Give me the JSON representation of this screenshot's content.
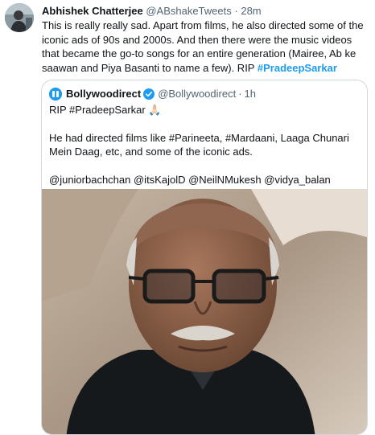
{
  "tweet": {
    "author_name": "Abhishek Chatterjee",
    "author_handle": "@ABshakeTweets",
    "separator": "·",
    "time": "28m",
    "text": "This is really really sad. Apart from films, he also directed some of the iconic ads of 90s and 2000s. And then there were the music videos that became the go-to songs for an entire generation (Mairee, Ab ke saawan and Piya Basanti to name a few). RIP",
    "hashtag": "#PradeepSarkar"
  },
  "quoted": {
    "author_name": "Bollywoodirect",
    "author_handle": "@Bollywoodirect",
    "separator": "·",
    "time": "1h",
    "line1": "RIP #PradeepSarkar 🙏🏻",
    "line2": "He had directed films like #Parineeta, #Mardaani, Laaga Chunari Mein Daag, etc, and some of the iconic ads.",
    "line3": "@juniorbachchan @itsKajolD @NeilNMukesh @vidya_balan"
  },
  "colors": {
    "link": "#1d9bf0",
    "secondary_text": "#536471",
    "border": "#cfd9de"
  }
}
